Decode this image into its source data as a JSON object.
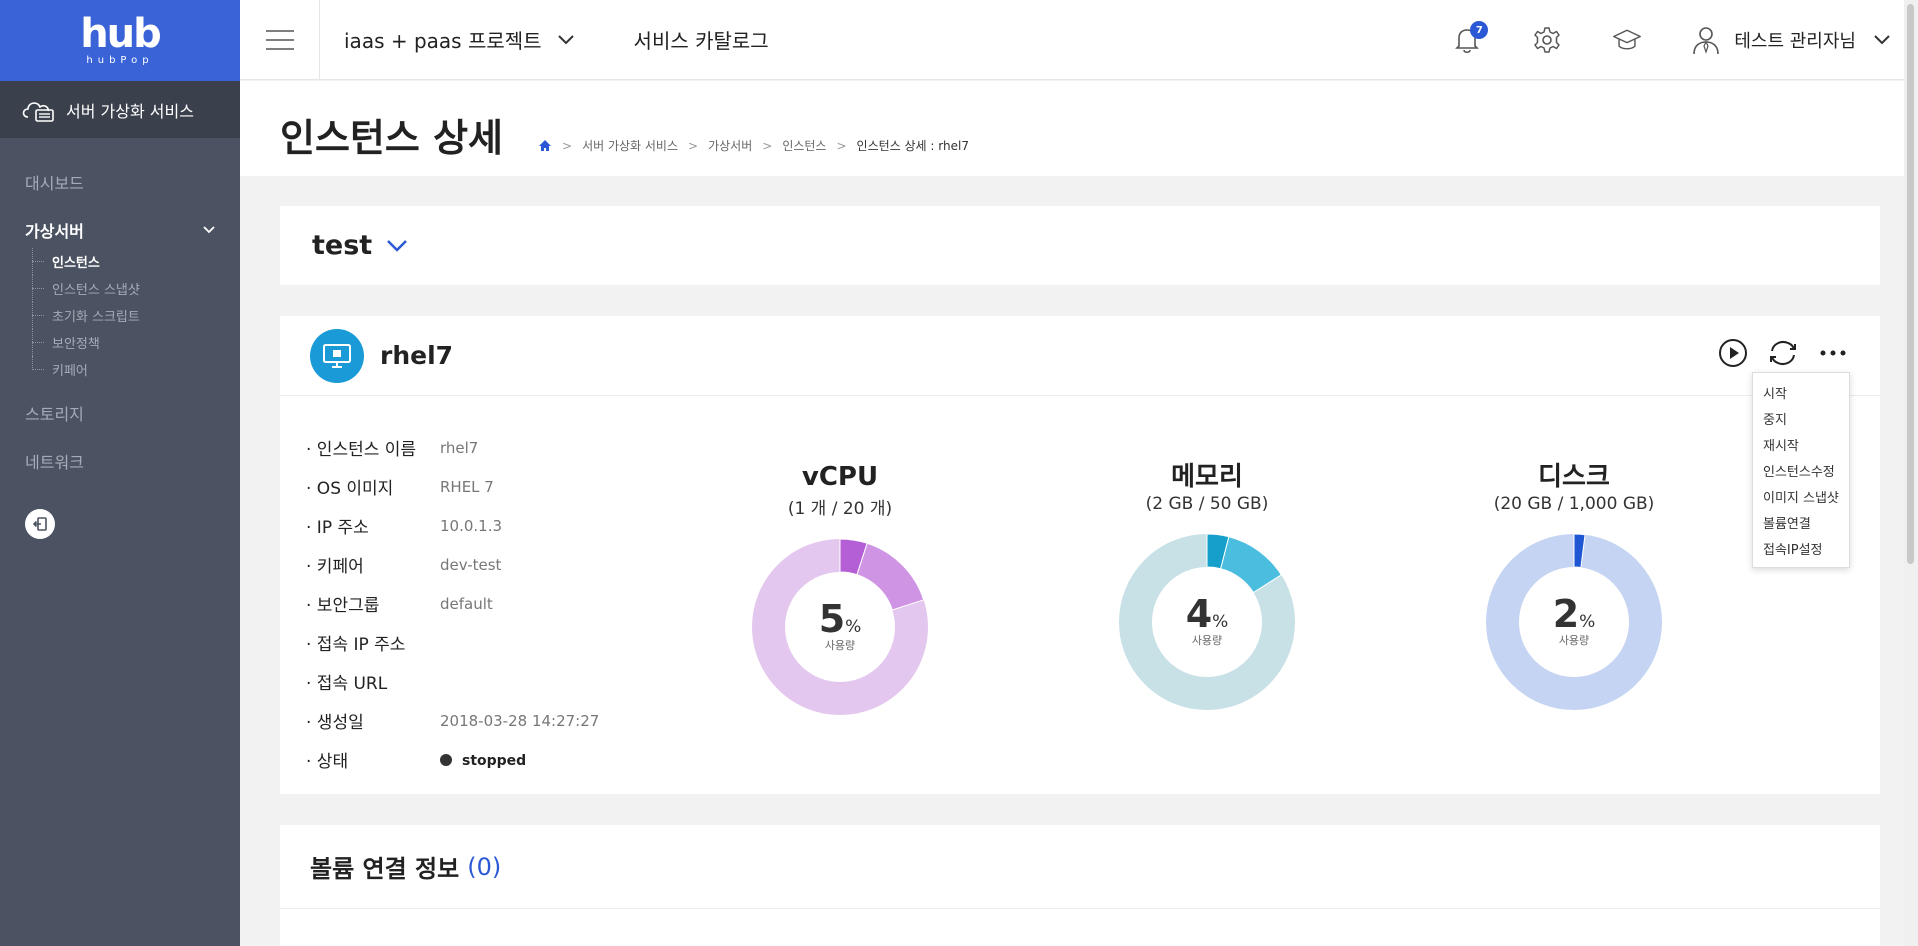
{
  "brand": {
    "logo_main": "hub",
    "logo_sub": "hubPop",
    "color": "#3a63d8"
  },
  "sidebar": {
    "service_name": "서버 가상화 서비스",
    "items": [
      {
        "label": "대시보드"
      },
      {
        "label": "가상서버",
        "expanded": true,
        "children": [
          {
            "label": "인스턴스",
            "active": true
          },
          {
            "label": "인스턴스 스냅샷"
          },
          {
            "label": "초기화 스크립트"
          },
          {
            "label": "보안정책"
          },
          {
            "label": "키페어"
          }
        ]
      },
      {
        "label": "스토리지"
      },
      {
        "label": "네트워크"
      }
    ]
  },
  "header": {
    "project": "iaas + paas 프로젝트",
    "catalog": "서비스 카탈로그",
    "notification_count": "7",
    "user_name": "테스트 관리자님"
  },
  "page": {
    "title": "인스턴스 상세",
    "breadcrumb": [
      "서버 가상화 서비스",
      "가상서버",
      "인스턴스",
      "인스턴스 상세 : rhel7"
    ]
  },
  "instance_select": {
    "value": "test"
  },
  "instance": {
    "name": "rhel7",
    "fields": [
      {
        "label": "· 인스턴스 이름",
        "value": "rhel7"
      },
      {
        "label": "· OS 이미지",
        "value": "RHEL 7"
      },
      {
        "label": "· IP 주소",
        "value": "10.0.1.3"
      },
      {
        "label": "· 키페어",
        "value": "dev-test"
      },
      {
        "label": "· 보안그룹",
        "value": "default"
      },
      {
        "label": "· 접속 IP 주소",
        "value": ""
      },
      {
        "label": "· 접속 URL",
        "value": ""
      },
      {
        "label": "· 생성일",
        "value": "2018-03-28 14:27:27"
      }
    ],
    "status_label": "· 상태",
    "status_value": "stopped"
  },
  "gauges": [
    {
      "title": "vCPU",
      "sub": "(1 개 / 20 개)",
      "pct": "5",
      "unit": "%",
      "used_label": "사용량",
      "segments": [
        0.05,
        0.15
      ],
      "colors": [
        "#b45fd6",
        "#cf94e4",
        "#e4c7ee"
      ]
    },
    {
      "title": "메모리",
      "sub": "(2 GB / 50 GB)",
      "pct": "4",
      "unit": "%",
      "used_label": "사용량",
      "segments": [
        0.04,
        0.12
      ],
      "colors": [
        "#159fca",
        "#4bbedf",
        "#c8e1e6"
      ]
    },
    {
      "title": "디스크",
      "sub": "(20 GB / 1,000 GB)",
      "pct": "2",
      "unit": "%",
      "used_label": "사용량",
      "segments": [
        0.02,
        0.0
      ],
      "colors": [
        "#1f56d4",
        "#1f56d4",
        "#c5d4f2"
      ]
    }
  ],
  "actions_menu": [
    "시작",
    "중지",
    "재시작",
    "인스턴스수정",
    "이미지 스냅샷",
    "볼륨연결",
    "접속IP설정"
  ],
  "volume": {
    "title": "볼륨 연결 정보",
    "count": "(0)"
  }
}
